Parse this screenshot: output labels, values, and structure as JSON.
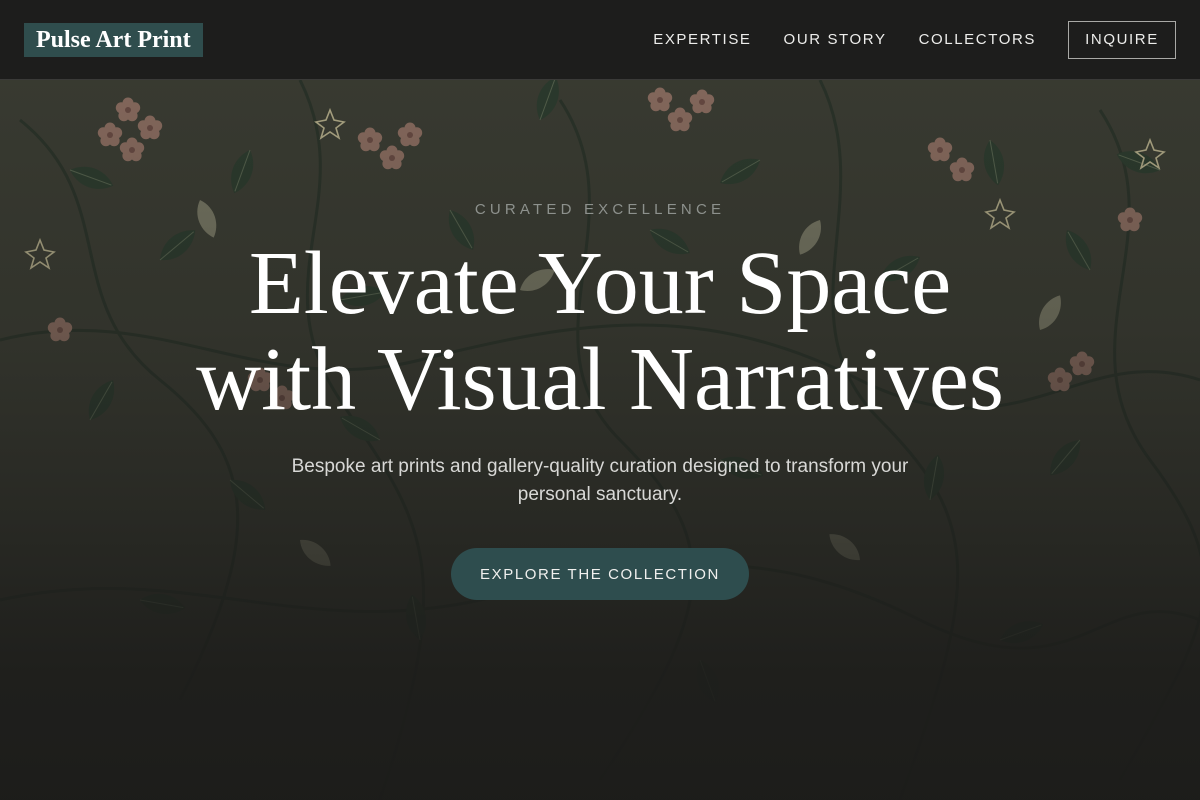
{
  "header": {
    "logo": "Pulse Art Print",
    "nav": [
      {
        "label": "EXPERTISE"
      },
      {
        "label": "OUR STORY"
      },
      {
        "label": "COLLECTORS"
      }
    ],
    "inquire_label": "INQUIRE"
  },
  "hero": {
    "eyebrow": "CURATED EXCELLENCE",
    "headline_line1": "Elevate Your Space",
    "headline_line2": "with Visual Narratives",
    "subtitle": "Bespoke art prints and gallery-quality curation designed to transform your personal sanctuary.",
    "cta_label": "EXPLORE THE COLLECTION",
    "background": "floral-tapestry-pattern"
  },
  "colors": {
    "header_bg": "#1d1d1c",
    "logo_bg": "#2f4d4d",
    "accent": "#2e4d4e",
    "eyebrow": "#8d918d",
    "text": "#ffffff"
  }
}
